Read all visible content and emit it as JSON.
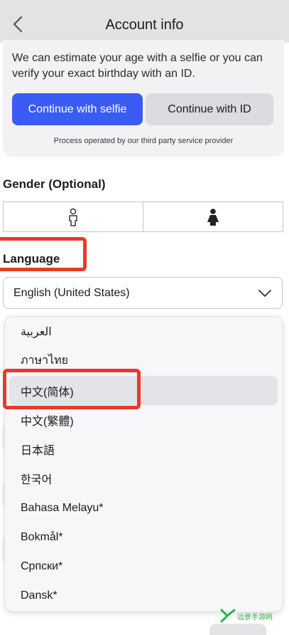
{
  "header": {
    "title": "Account info"
  },
  "verification": {
    "description": "We can estimate your age with a selfie or you can verify your exact birthday with an ID.",
    "selfie_button": "Continue with selfie",
    "id_button": "Continue with ID",
    "provider_note": "Process operated by our third party service provider"
  },
  "gender": {
    "label": "Gender (Optional)",
    "options": [
      "male-icon",
      "female-icon"
    ]
  },
  "language": {
    "label": "Language",
    "selected": "English (United States)",
    "options": [
      "العربية",
      "ภาษาไทย",
      "中文(简体)",
      "中文(繁體)",
      "日本語",
      "한국어",
      "Bahasa Melayu*",
      "Bokmål*",
      "Српски*",
      "Dansk*"
    ],
    "highlighted_option": "中文(简体)"
  },
  "colors": {
    "accent": "#3a5cf5",
    "annotation": "#e83a2a",
    "header_bg": "#e3e3e6"
  },
  "watermark": {
    "text": "远景手游网"
  }
}
